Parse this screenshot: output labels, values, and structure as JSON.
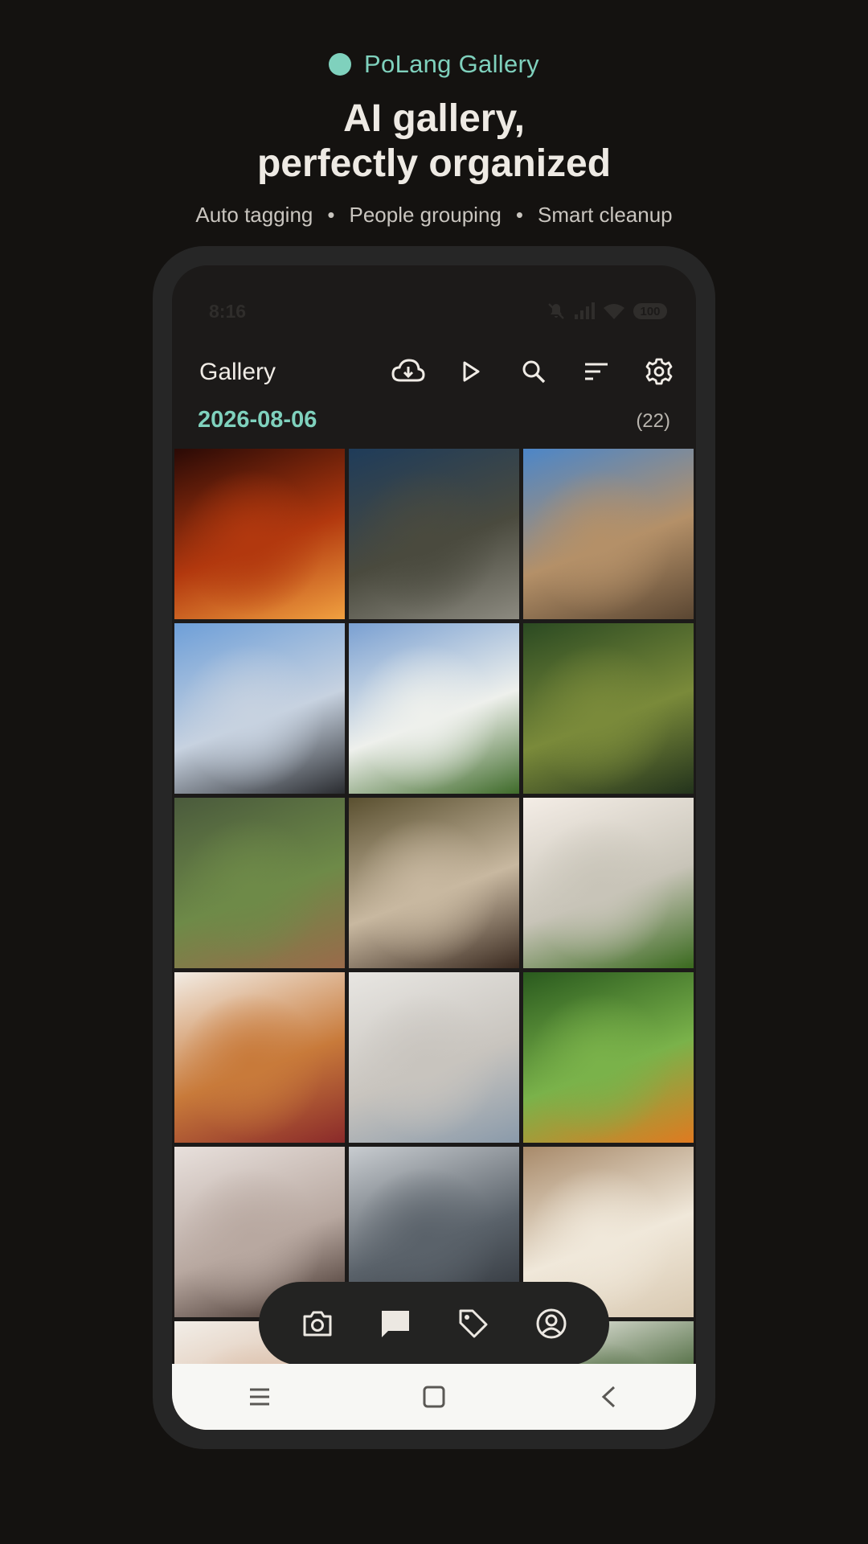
{
  "promo": {
    "brand": "PoLang Gallery",
    "headline_line1": "AI gallery,",
    "headline_line2": "perfectly organized",
    "features": [
      "Auto tagging",
      "People grouping",
      "Smart cleanup"
    ],
    "separator": "•"
  },
  "status_bar": {
    "time": "8:16",
    "battery": "100",
    "icons": [
      "mute-icon",
      "signal-icon",
      "wifi-icon",
      "battery-icon"
    ]
  },
  "app_bar": {
    "title": "Gallery",
    "actions": [
      "cloud-download-icon",
      "play-icon",
      "search-icon",
      "sort-icon",
      "settings-icon"
    ]
  },
  "section": {
    "date": "2026-08-06",
    "count": "(22)"
  },
  "photos": [
    {
      "name": "photo-woman-red-fire",
      "colors": [
        "#2a0a06",
        "#b2380e",
        "#f0a040"
      ]
    },
    {
      "name": "photo-bride-stone-house",
      "colors": [
        "#1f3c5a",
        "#4a4a3e",
        "#8c8a80"
      ]
    },
    {
      "name": "photo-ancient-temple-ruins",
      "colors": [
        "#4c86c8",
        "#b49068",
        "#5a4632"
      ]
    },
    {
      "name": "photo-waterfall-snow",
      "colors": [
        "#6e9fd8",
        "#c7d2e0",
        "#2a2c30"
      ]
    },
    {
      "name": "photo-white-roses-sky",
      "colors": [
        "#7aa0d2",
        "#eef0ec",
        "#3f6b2a"
      ]
    },
    {
      "name": "photo-aerial-green-fields",
      "colors": [
        "#2b4a22",
        "#7a8a3a",
        "#23331c"
      ]
    },
    {
      "name": "photo-terraced-village",
      "colors": [
        "#4a5a3c",
        "#6e8a48",
        "#9a6a4a"
      ]
    },
    {
      "name": "photo-couple-hugging",
      "colors": [
        "#5a5030",
        "#c8b8a0",
        "#3a2a20"
      ]
    },
    {
      "name": "photo-white-horse-meadow",
      "colors": [
        "#f4ede6",
        "#c8c4b8",
        "#3a6a1e"
      ]
    },
    {
      "name": "photo-breakfast-table",
      "colors": [
        "#f2ece4",
        "#c87a3a",
        "#8a2a2a"
      ]
    },
    {
      "name": "photo-mother-child-studio",
      "colors": [
        "#e8e6e2",
        "#c8c4be",
        "#8a9aaa"
      ]
    },
    {
      "name": "photo-toucans-tree",
      "colors": [
        "#2a5a1e",
        "#7ab24a",
        "#e07a20"
      ]
    },
    {
      "name": "photo-woman-kitchen",
      "colors": [
        "#e8e0dc",
        "#b8a8a0",
        "#3a2a24"
      ]
    },
    {
      "name": "photo-city-skyline",
      "colors": [
        "#c8ccd0",
        "#5a626a",
        "#2a2e34"
      ]
    },
    {
      "name": "photo-chandelier-curtain",
      "colors": [
        "#a88a6a",
        "#f0e8da",
        "#d8c8b0"
      ]
    },
    {
      "name": "photo-woman-portrait-1",
      "colors": [
        "#f2eee8",
        "#d8b8a0",
        "#2a2220"
      ]
    },
    {
      "name": "photo-woman-portrait-2",
      "colors": [
        "#eeeae6",
        "#c09a80",
        "#3a2e28"
      ]
    },
    {
      "name": "photo-street-town",
      "colors": [
        "#f4f2ee",
        "#3a5a2a",
        "#c8c0b4"
      ]
    }
  ],
  "bottom_nav": [
    "camera-icon",
    "chat-icon",
    "tag-icon",
    "account-icon"
  ],
  "system_nav": [
    "menu-icon",
    "home-icon",
    "back-icon"
  ]
}
